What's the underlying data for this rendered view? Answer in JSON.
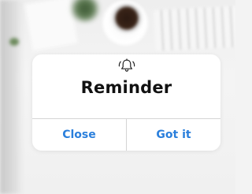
{
  "background": {
    "description_icon": "blurred-desk-photo"
  },
  "alert": {
    "icon": "bell-icon",
    "title": "Reminder",
    "buttons": {
      "close_label": "Close",
      "got_it_label": "Got it"
    }
  },
  "colors": {
    "accent": "#2a7fdc",
    "title": "#111111",
    "card": "#ffffff",
    "divider": "#d4d4d4"
  }
}
